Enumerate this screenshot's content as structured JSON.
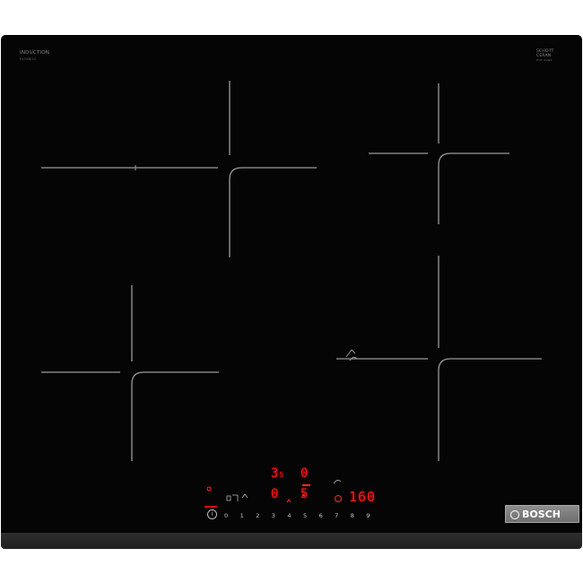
{
  "hob": {
    "badge_left_title": "INDUCTION",
    "badge_left_sub": "PXY6BJ1C",
    "badge_right_title_1": "SCHOTT",
    "badge_right_title_2": "CERAN",
    "badge_right_sub": "HOT ZONE",
    "brand": "BOSCH"
  },
  "controls": {
    "display_top_left": "3",
    "display_top_left_sub": "5",
    "display_top_right": "0",
    "display_mid_left": "0",
    "display_mid_right": "5",
    "timer_readout": "160",
    "scale": [
      "0",
      "1",
      "2",
      "3",
      "4",
      "5",
      "6",
      "7",
      "8",
      "9"
    ],
    "power_symbol": "I"
  },
  "colors": {
    "glass": "#050505",
    "display_red": "#ff1a1a",
    "zone_marking": "#9a9a9a",
    "badge_grey": "#7d7d7d"
  }
}
